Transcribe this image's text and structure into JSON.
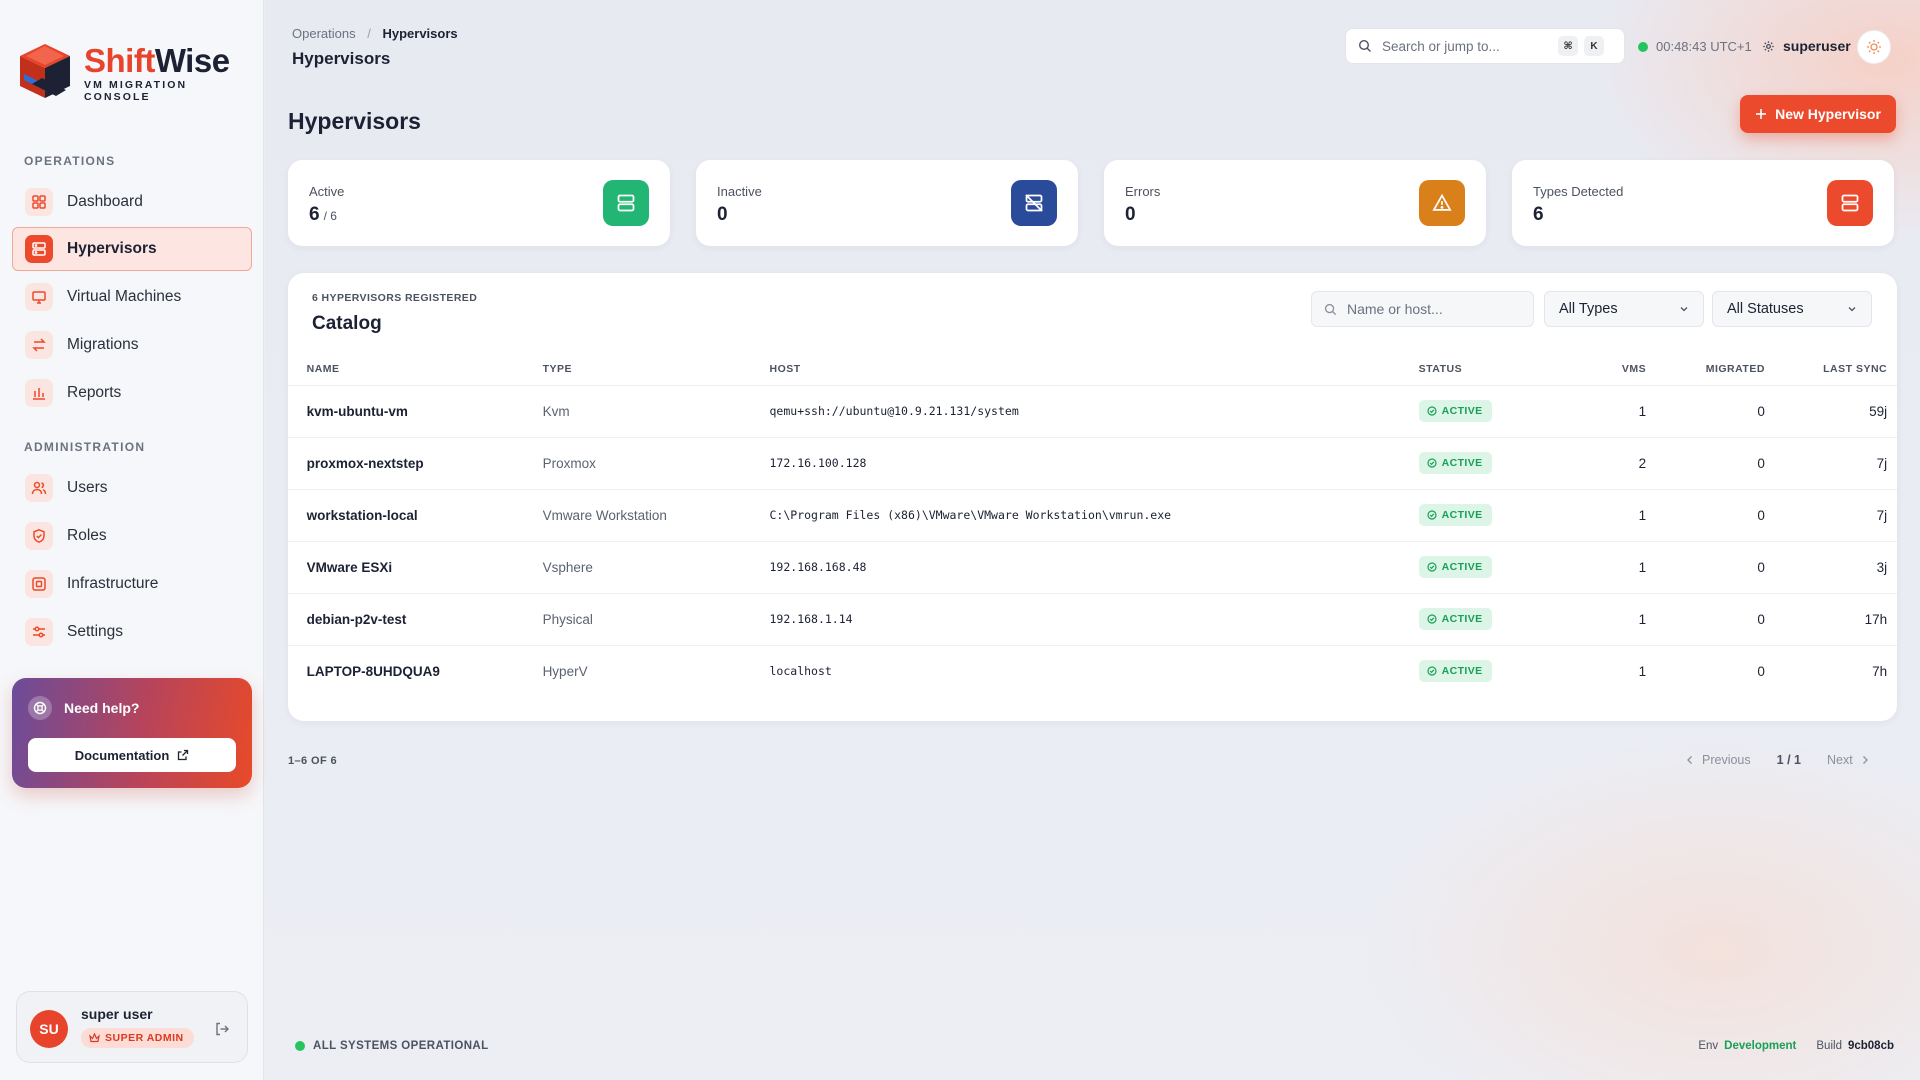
{
  "brand": {
    "name_part1": "Shift",
    "name_part2": "Wise",
    "tagline": "VM MIGRATION CONSOLE",
    "accent": "#ec4a2c"
  },
  "sidebar": {
    "operations_heading": "OPERATIONS",
    "operations": [
      {
        "label": "Dashboard",
        "icon": "dashboard-icon",
        "active": false
      },
      {
        "label": "Hypervisors",
        "icon": "server-icon",
        "active": true
      },
      {
        "label": "Virtual Machines",
        "icon": "monitor-icon",
        "active": false
      },
      {
        "label": "Migrations",
        "icon": "arrows-exchange-icon",
        "active": false
      },
      {
        "label": "Reports",
        "icon": "bar-chart-icon",
        "active": false
      }
    ],
    "administration_heading": "ADMINISTRATION",
    "administration": [
      {
        "label": "Users",
        "icon": "users-icon",
        "active": false
      },
      {
        "label": "Roles",
        "icon": "shield-icon",
        "active": false
      },
      {
        "label": "Infrastructure",
        "icon": "infrastructure-icon",
        "active": false
      },
      {
        "label": "Settings",
        "icon": "sliders-icon",
        "active": false
      }
    ],
    "help": {
      "title": "Need help?",
      "doc_button": "Documentation"
    },
    "user": {
      "initials": "SU",
      "name": "super user",
      "role": "SUPER ADMIN"
    }
  },
  "header": {
    "breadcrumb_parent": "Operations",
    "breadcrumb_separator": "/",
    "breadcrumb_current": "Hypervisors",
    "title": "Hypervisors",
    "search_placeholder": "Search or jump to...",
    "shortcut_key1": "⌘",
    "shortcut_key2": "K",
    "clock": "00:48:43 UTC+1",
    "username": "superuser"
  },
  "page": {
    "title": "Hypervisors",
    "new_button": "New Hypervisor"
  },
  "stats": [
    {
      "label": "Active",
      "value": "6",
      "of": "/ 6",
      "color": "#22b573",
      "icon": "server-icon"
    },
    {
      "label": "Inactive",
      "value": "0",
      "of": "",
      "color": "#2a4a9a",
      "icon": "server-off-icon"
    },
    {
      "label": "Errors",
      "value": "0",
      "of": "",
      "color": "#d9801b",
      "icon": "warning-icon"
    },
    {
      "label": "Types Detected",
      "value": "6",
      "of": "",
      "color": "#ec4a2c",
      "icon": "server-icon"
    }
  ],
  "catalog": {
    "subtitle": "6 HYPERVISORS REGISTERED",
    "title": "Catalog",
    "filter_placeholder": "Name or host...",
    "type_select": "All Types",
    "status_select": "All Statuses",
    "columns": [
      "NAME",
      "TYPE",
      "HOST",
      "STATUS",
      "VMS",
      "MIGRATED",
      "LAST SYNC"
    ],
    "rows": [
      {
        "name": "kvm-ubuntu-vm",
        "type": "Kvm",
        "host": "qemu+ssh://ubuntu@10.9.21.131/system",
        "status": "ACTIVE",
        "vms": "1",
        "migrated": "0",
        "last_sync": "59j"
      },
      {
        "name": "proxmox-nextstep",
        "type": "Proxmox",
        "host": "172.16.100.128",
        "status": "ACTIVE",
        "vms": "2",
        "migrated": "0",
        "last_sync": "7j"
      },
      {
        "name": "workstation-local",
        "type": "Vmware Workstation",
        "host": "C:\\Program Files (x86)\\VMware\\VMware Workstation\\vmrun.exe",
        "status": "ACTIVE",
        "vms": "1",
        "migrated": "0",
        "last_sync": "7j"
      },
      {
        "name": "VMware ESXi",
        "type": "Vsphere",
        "host": "192.168.168.48",
        "status": "ACTIVE",
        "vms": "1",
        "migrated": "0",
        "last_sync": "3j"
      },
      {
        "name": "debian-p2v-test",
        "type": "Physical",
        "host": "192.168.1.14",
        "status": "ACTIVE",
        "vms": "1",
        "migrated": "0",
        "last_sync": "17h"
      },
      {
        "name": "LAPTOP-8UHDQUA9",
        "type": "HyperV",
        "host": "localhost",
        "status": "ACTIVE",
        "vms": "1",
        "migrated": "0",
        "last_sync": "7h"
      }
    ]
  },
  "pagination": {
    "count": "1–6 OF 6",
    "previous": "Previous",
    "page": "1 / 1",
    "next": "Next"
  },
  "footer": {
    "status": "ALL SYSTEMS OPERATIONAL",
    "env_label": "Env",
    "env_value": "Development",
    "build_label": "Build",
    "build_value": "9cb08cb"
  }
}
